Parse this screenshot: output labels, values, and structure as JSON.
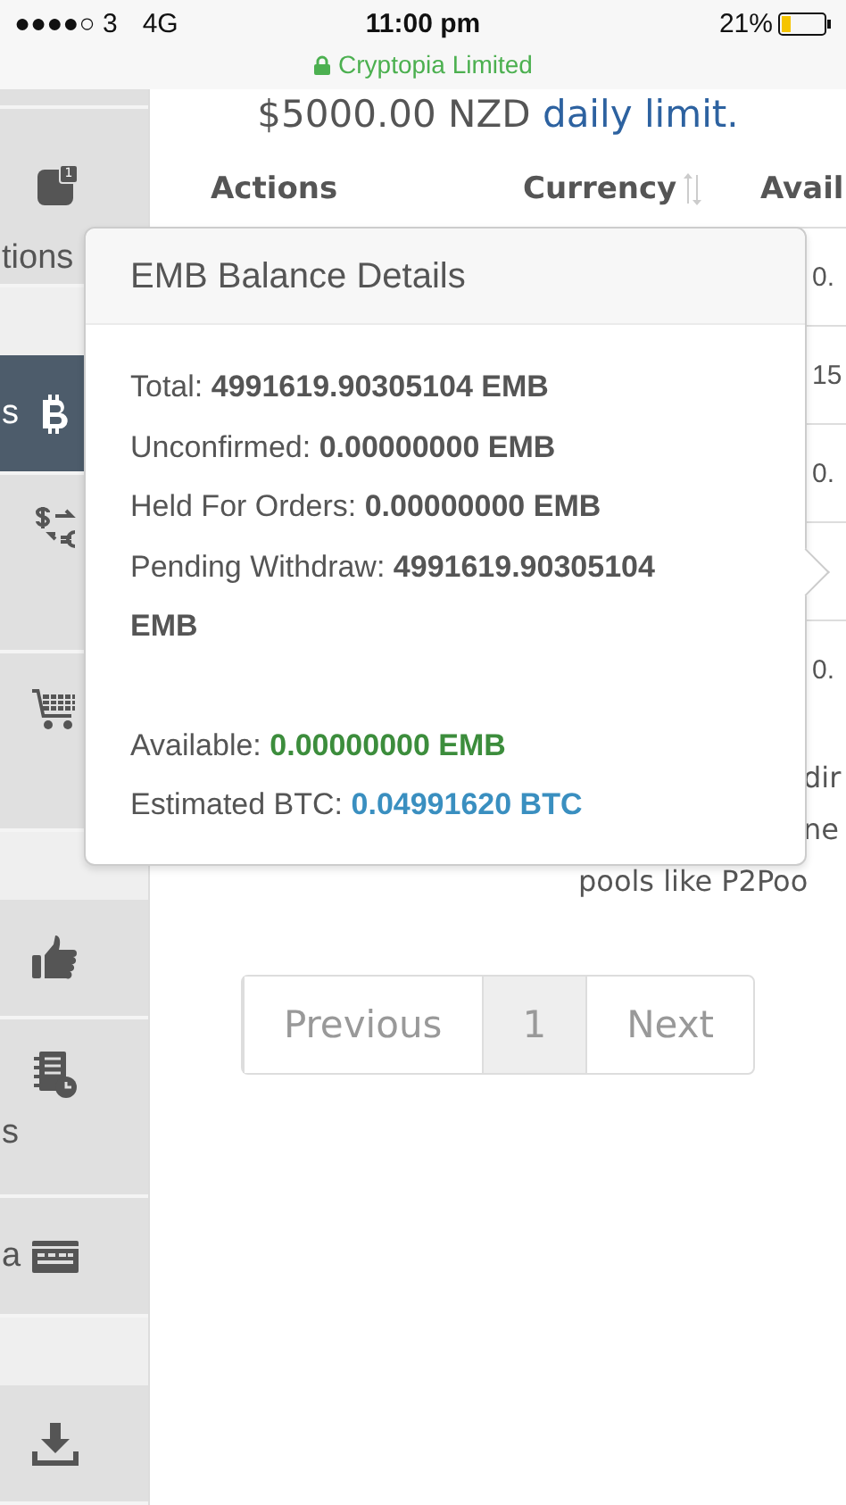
{
  "status_bar": {
    "carrier": "●●●●○ 3",
    "network": "4G",
    "time": "11:00 pm",
    "site": "Cryptopia Limited",
    "battery": "21%"
  },
  "sidebar": {
    "sections": [
      [
        {
          "kind": "stacked",
          "label": "tions",
          "badge": "1",
          "selected": false
        }
      ],
      [
        {
          "kind": "inline",
          "label": "s",
          "selected": true
        },
        {
          "kind": "stacked",
          "selected": false
        },
        {
          "kind": "stacked",
          "selected": false
        }
      ],
      [
        {
          "kind": "inline",
          "selected": false
        },
        {
          "kind": "stacked",
          "label": "s",
          "selected": false
        },
        {
          "kind": "inline",
          "label": "a",
          "selected": false
        }
      ],
      [
        {
          "kind": "inline",
          "selected": false
        }
      ]
    ]
  },
  "limit_notice": {
    "amount": "$5000.00 NZD",
    "link": "daily limit."
  },
  "table": {
    "columns": [
      "Actions",
      "Currency",
      "Avail"
    ],
    "rows": [
      {
        "column_3": "0."
      },
      {
        "column_3": "15"
      },
      {
        "column_3": "0."
      },
      {},
      {
        "column_3": "0."
      }
    ]
  },
  "description_fragments": [
    "dir",
    "ne",
    "pools like P2Poo"
  ],
  "popover": {
    "title": "EMB Balance Details",
    "groups": [
      [
        {
          "label": "Total:",
          "value": "4991619.90305104 EMB",
          "kind": "plain"
        },
        {
          "label": "Unconfirmed:",
          "value": "0.00000000 EMB",
          "kind": "plain"
        },
        {
          "label": "Held For Orders:",
          "value": "0.00000000 EMB",
          "kind": "plain"
        },
        {
          "label": "Pending Withdraw:",
          "value": "4991619.90305104 EMB",
          "kind": "plain"
        }
      ],
      [
        {
          "label": "Available:",
          "value": "0.00000000 EMB",
          "kind": "positive"
        },
        {
          "label": "Estimated BTC:",
          "value": "0.04991620 BTC",
          "kind": "info"
        }
      ]
    ]
  },
  "pagination": [
    {
      "label": "Previous",
      "selected": false
    },
    {
      "label": "1",
      "selected": true
    },
    {
      "label": "Next",
      "selected": false
    }
  ]
}
